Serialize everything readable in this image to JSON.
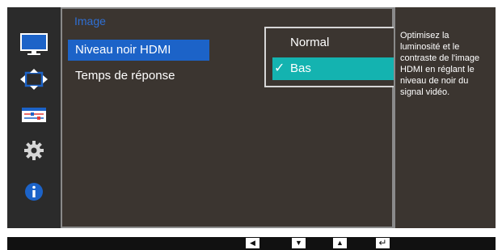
{
  "colors": {
    "accent": "#1c63c8",
    "selected_option": "#14b3b0",
    "panel": "#3b3530",
    "frame": "#2b2b2b"
  },
  "sidebar": {
    "items": [
      {
        "icon": "monitor-icon"
      },
      {
        "icon": "screen-size-arrows-icon"
      },
      {
        "icon": "sliders-icon"
      },
      {
        "icon": "gear-icon"
      },
      {
        "icon": "info-icon"
      }
    ]
  },
  "menu": {
    "title": "Image",
    "items": [
      {
        "label": "Niveau noir HDMI",
        "selected": true
      },
      {
        "label": "Temps de réponse",
        "selected": false
      }
    ]
  },
  "dropdown": {
    "options": [
      {
        "label": "Normal",
        "selected": false
      },
      {
        "label": "Bas",
        "selected": true
      }
    ],
    "check_glyph": "✓"
  },
  "help": {
    "text": "Optimisez la luminosité et le contraste de l'image HDMI en réglant le niveau de noir du signal vidéo."
  },
  "nav_keys": [
    {
      "icon": "left-arrow-icon",
      "glyph": "◀"
    },
    {
      "icon": "down-arrow-icon",
      "glyph": "▼"
    },
    {
      "icon": "up-arrow-icon",
      "glyph": "▲"
    },
    {
      "icon": "enter-icon",
      "glyph": "↵"
    }
  ]
}
